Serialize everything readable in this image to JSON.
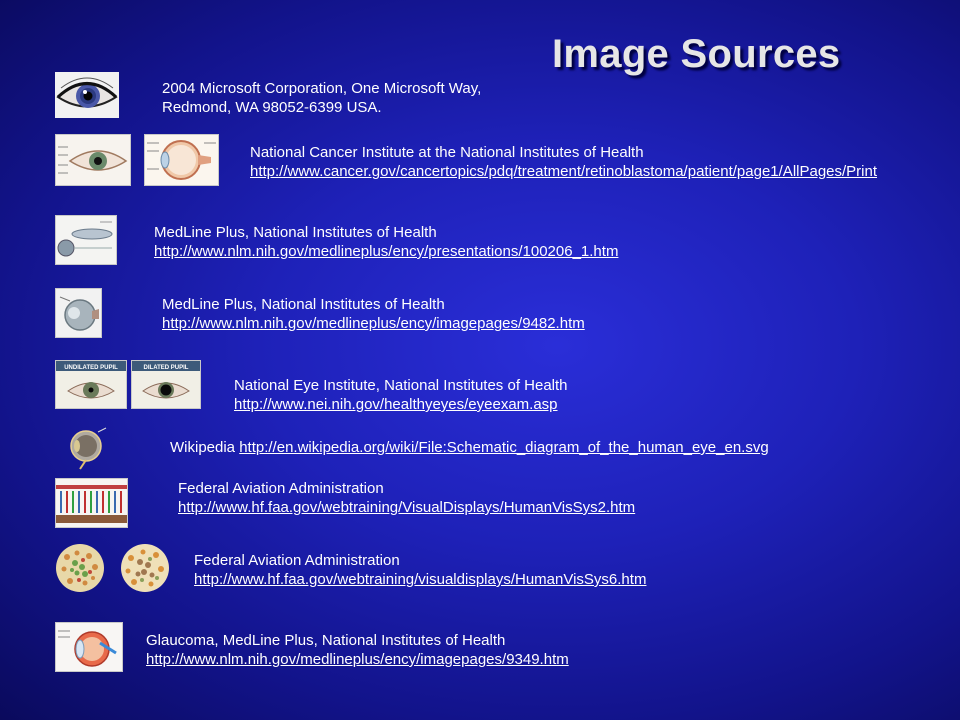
{
  "title": "Image Sources",
  "sources": [
    {
      "line1": "2004 Microsoft Corporation, One Microsoft Way,",
      "line2": "Redmond, WA 98052-6399 USA.",
      "thumbs": [
        "eye-photo-icon"
      ]
    },
    {
      "line1": "National Cancer Institute at the National Institutes of Health",
      "url": "http://www.cancer.gov/cancertopics/pdq/treatment/retinoblastoma/patient/page1/AllPages/Print",
      "thumbs": [
        "eye-anatomy-front-icon",
        "eye-cross-section-icon"
      ]
    },
    {
      "line1": "MedLine Plus, National Institutes of Health",
      "url": "http://www.nlm.nih.gov/medlineplus/ency/presentations/100206_1.htm",
      "thumbs": [
        "lens-diagram-icon"
      ]
    },
    {
      "line1": "MedLine Plus, National Institutes of Health",
      "url": "http://www.nlm.nih.gov/medlineplus/ency/imagepages/9482.htm",
      "thumbs": [
        "eyeball-model-icon"
      ]
    },
    {
      "line1": "National Eye Institute, National Institutes of Health",
      "url": "http://www.nei.nih.gov/healthyeyes/eyeexam.asp",
      "thumbs": [
        "undilated-pupil-icon",
        "dilated-pupil-icon"
      ],
      "pupil_labels": [
        "UNDILATED PUPIL",
        "DILATED PUPIL"
      ]
    },
    {
      "line1": "Wikipedia",
      "url": "http://en.wikipedia.org/wiki/File:Schematic_diagram_of_the_human_eye_en.svg",
      "thumbs": [
        "schematic-eye-icon"
      ]
    },
    {
      "line1": "Federal Aviation Administration",
      "url": "http://www.hf.faa.gov/webtraining/VisualDisplays/HumanVisSys2.htm",
      "thumbs": [
        "retina-cells-icon"
      ]
    },
    {
      "line1": "Federal Aviation Administration",
      "url": "http://www.hf.faa.gov/webtraining/visualdisplays/HumanVisSys6.htm",
      "thumbs": [
        "color-blind-test-icon-1",
        "color-blind-test-icon-2"
      ]
    },
    {
      "line1": "Glaucoma, MedLine Plus, National Institutes of Health",
      "url": "http://www.nlm.nih.gov/medlineplus/ency/imagepages/9349.htm",
      "thumbs": [
        "glaucoma-diagram-icon"
      ]
    }
  ]
}
